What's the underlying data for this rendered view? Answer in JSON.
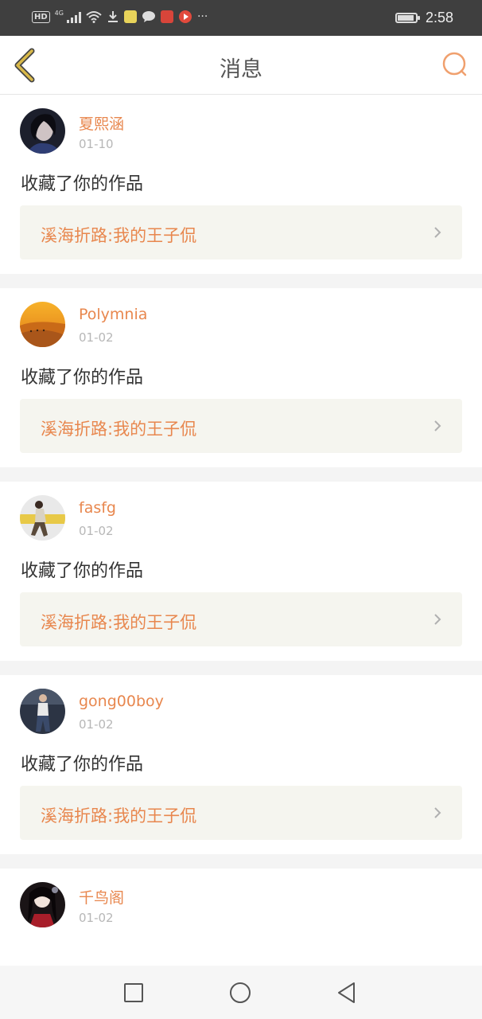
{
  "status_bar": {
    "hd_label": "HD",
    "network_label": "4G",
    "overflow_label": "···",
    "time": "2:58",
    "battery_level": 0.9
  },
  "header": {
    "title": "消息"
  },
  "messages": [
    {
      "user": "夏熙涵",
      "date": "01-10",
      "action": "收藏了你的作品",
      "work_title": "溪海折路:我的王子侃"
    },
    {
      "user": "Polymnia",
      "date": "01-02",
      "action": "收藏了你的作品",
      "work_title": "溪海折路:我的王子侃"
    },
    {
      "user": "fasfg",
      "date": "01-02",
      "action": "收藏了你的作品",
      "work_title": "溪海折路:我的王子侃"
    },
    {
      "user": "gong00boy",
      "date": "01-02",
      "action": "收藏了你的作品",
      "work_title": "溪海折路:我的王子侃"
    },
    {
      "user": "千鸟阁",
      "date": "01-02",
      "action": "",
      "work_title": ""
    }
  ],
  "colors": {
    "accent": "#e8874e",
    "back_icon": "#d9b94a",
    "work_bg": "#f5f5ef"
  }
}
